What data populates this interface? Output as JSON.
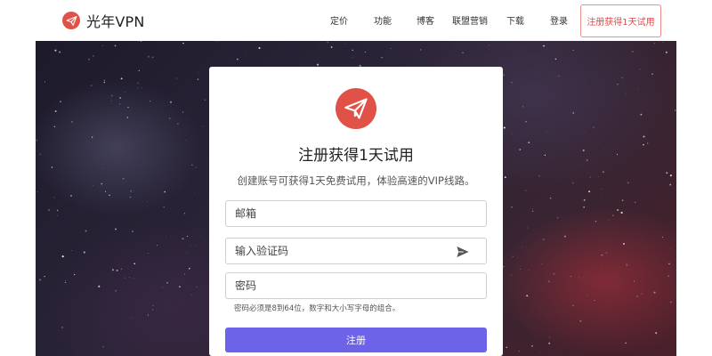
{
  "brand": {
    "name": "光年VPN",
    "logo_icon": "paper-plane-icon"
  },
  "nav": {
    "items": [
      {
        "label": "定价"
      },
      {
        "label": "功能"
      },
      {
        "label": "博客"
      },
      {
        "label": "联盟营销"
      },
      {
        "label": "下载"
      },
      {
        "label": "登录"
      }
    ],
    "cta_label": "注册获得1天试用"
  },
  "signup": {
    "logo_icon": "paper-plane-icon",
    "title": "注册获得1天试用",
    "subtitle": "创建账号可获得1天免费试用，体验高速的VIP线路。",
    "email_placeholder": "邮箱",
    "code_placeholder": "输入验证码",
    "send_icon": "send-icon",
    "password_placeholder": "密码",
    "password_hint": "密码必须是8到64位，数字和大小写字母的组合。",
    "submit_label": "注册"
  },
  "colors": {
    "brand_red": "#e05248",
    "cta_border": "#ef8c8c",
    "submit_purple": "#6d63e8"
  }
}
